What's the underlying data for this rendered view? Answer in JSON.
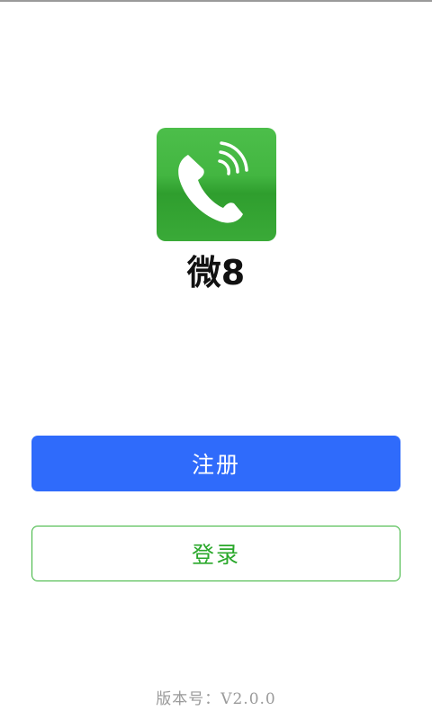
{
  "app": {
    "name": "微8",
    "icon": "phone-call-icon",
    "icon_color": "#43b641"
  },
  "buttons": {
    "register_label": "注册",
    "login_label": "登录"
  },
  "footer": {
    "version_text": "版本号：V2.0.0"
  },
  "colors": {
    "register_bg": "#2f6bfb",
    "login_border": "#39b43a",
    "login_text": "#2aa82b"
  }
}
